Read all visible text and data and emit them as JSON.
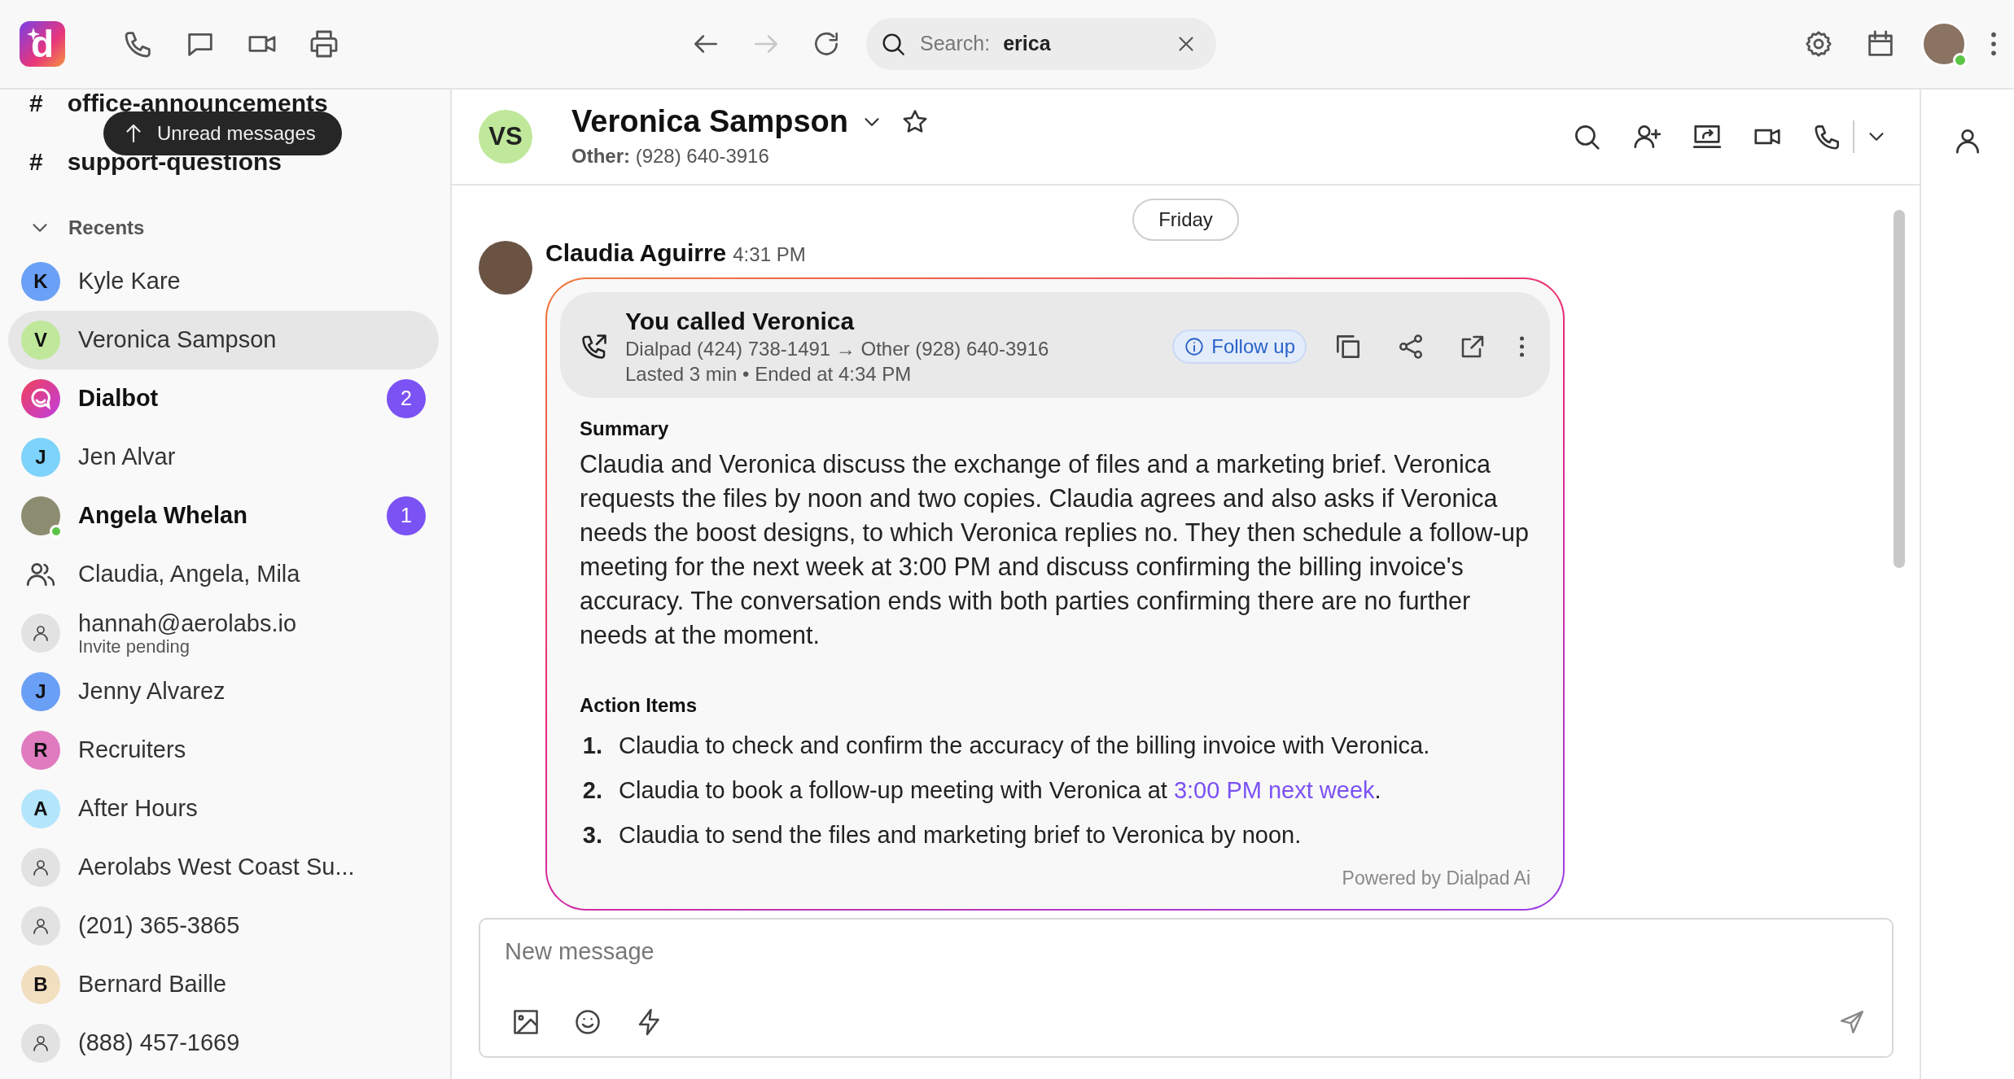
{
  "app_logo": {
    "letter": "d"
  },
  "toolbar": {
    "tools": [
      {
        "kind": "phone"
      },
      {
        "kind": "chat"
      },
      {
        "kind": "video"
      },
      {
        "kind": "print"
      }
    ],
    "nav": [
      {
        "kind": "back",
        "disabled": false
      },
      {
        "kind": "forward",
        "disabled": true
      },
      {
        "kind": "reload",
        "disabled": false
      }
    ],
    "search": {
      "label": "Search:",
      "value": "erica"
    },
    "user": {
      "online": true
    }
  },
  "sidebar": {
    "channels": [
      {
        "mark": "#",
        "name": "office-announcements"
      },
      {
        "mark": "#",
        "name": "support-questions"
      }
    ],
    "unread_pill": "Unread messages",
    "recents": {
      "title": "Recents",
      "expanded": true,
      "items": [
        {
          "kind": "initial",
          "initial": "K",
          "name": "Kyle Kare",
          "color": "#6aa0f6",
          "selected": false
        },
        {
          "kind": "initial",
          "initial": "V",
          "name": "Veronica Sampson",
          "color": "#bfe89a",
          "selected": true
        },
        {
          "kind": "bot",
          "name": "Dialbot",
          "badge": "2",
          "selected": false
        },
        {
          "kind": "initial",
          "initial": "J",
          "name": "Jen Alvar",
          "color": "#7dd3fb",
          "selected": false
        },
        {
          "kind": "photo",
          "name": "Angela Whelan",
          "badge": "1",
          "online": true,
          "selected": false
        },
        {
          "kind": "group",
          "name": "Claudia, Angela, Mila",
          "selected": false
        },
        {
          "kind": "contact",
          "name": "hannah@aerolabs.io",
          "subtitle": "Invite pending",
          "selected": false
        },
        {
          "kind": "initial",
          "initial": "J",
          "name": "Jenny Alvarez",
          "color": "#6a9ff6",
          "selected": false
        },
        {
          "kind": "initial",
          "initial": "R",
          "name": "Recruiters",
          "color": "#e07bbf",
          "selected": false
        },
        {
          "kind": "initial",
          "initial": "A",
          "name": "After Hours",
          "color": "#b3e5fb",
          "selected": false
        },
        {
          "kind": "contact",
          "name": "Aerolabs West Coast Su...",
          "selected": false
        },
        {
          "kind": "contact",
          "name": "(201) 365-3865",
          "selected": false
        },
        {
          "kind": "initial",
          "initial": "B",
          "name": "Bernard Baille",
          "color": "#f2dfc0",
          "selected": false
        },
        {
          "kind": "contact",
          "name": "(888) 457-1669",
          "selected": false
        }
      ]
    }
  },
  "conversation": {
    "header": {
      "initials": "VS",
      "name": "Veronica Sampson",
      "subtitle": "**Other:** (928) 640-3916",
      "starred": false,
      "actions": [
        {
          "kind": "search"
        },
        {
          "kind": "add-person"
        },
        {
          "kind": "share-screen"
        },
        {
          "kind": "video"
        },
        {
          "kind": "call"
        }
      ]
    },
    "date_divider": "Friday",
    "message": {
      "sender": "Claudia Aguirre",
      "time": "4:31 PM",
      "call": {
        "title": "You called Veronica",
        "route": "Dialpad (424) 738-1491 → Other (928) 640-3916",
        "details": "Lasted 3 min • Ended at 4:34 PM",
        "follow_up": "Follow up"
      },
      "summary_heading": "Summary",
      "summary": "Claudia and Veronica discuss the exchange of files and a marketing brief. Veronica requests the files by noon and two copies. Claudia agrees and also asks if Veronica needs the boost designs, to which Veronica replies no. They then schedule a follow-up meeting for the next week at 3:00 PM and discuss confirming the billing invoice's accuracy. The conversation ends with both parties confirming there are no further needs at the moment.",
      "action_heading": "Action Items",
      "action_items": [
        {
          "number": "1.",
          "text": "Claudia to check and confirm the accuracy of the billing invoice with Veronica."
        },
        {
          "number": "2.",
          "text": "Claudia to book a follow-up meeting with Veronica at ",
          "link": "3:00 PM next week",
          "after": "."
        },
        {
          "number": "3.",
          "text": "Claudia to send the files and marketing brief to Veronica by noon."
        }
      ],
      "footer": "Powered by Dialpad Ai"
    },
    "composer": {
      "placeholder": "New message"
    }
  }
}
